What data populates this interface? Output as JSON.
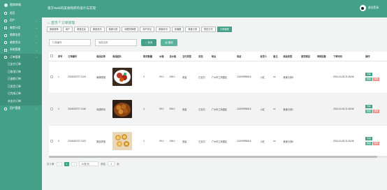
{
  "app": {
    "logo_text": "图商商城",
    "title": "基于Web的美食购买的设计与实现",
    "user_name": "退出登录"
  },
  "sidebar": {
    "items": [
      {
        "label": "首页",
        "has_arrow": false
      },
      {
        "label": "用户",
        "has_arrow": true
      },
      {
        "label": "美食分类",
        "has_arrow": true
      },
      {
        "label": "美食信息",
        "has_arrow": true
      },
      {
        "label": "美食资讯",
        "has_arrow": true
      },
      {
        "label": "系统管理",
        "has_arrow": true
      },
      {
        "label": "订单管理",
        "has_arrow": true
      }
    ],
    "sub_items": [
      "已支付订单",
      "已取消订单",
      "已退款订单",
      "已发货订单",
      "已完成订单",
      "未支付订单"
    ],
    "bottom_item": {
      "label": "用户管理",
      "has_arrow": true
    }
  },
  "breadcrumb": {
    "home": "首页",
    "separator": "/",
    "current": "订单管理"
  },
  "tabs": [
    {
      "label": "美食推荐"
    },
    {
      "label": "用户"
    },
    {
      "label": "美食信息"
    },
    {
      "label": "美食资讯"
    },
    {
      "label": "美食分类"
    },
    {
      "label": "收藏夹管理"
    },
    {
      "label": "用户评论"
    },
    {
      "label": "美食资讯"
    },
    {
      "label": "轮播图"
    },
    {
      "label": "美食分类"
    },
    {
      "label": "配送方式"
    },
    {
      "label": "订单管理",
      "active": true
    }
  ],
  "filters": {
    "order_no_placeholder": "订单编号",
    "dish_name_placeholder": "商品名称",
    "search_label": "查询",
    "delete_label": "删除"
  },
  "table": {
    "columns": [
      "序号",
      "订单编号",
      "商品名称",
      "商品图片",
      "购买数量",
      "价格",
      "总价格",
      "支付类型",
      "状态",
      "地址",
      "电话",
      "收货人",
      "备注",
      "商品类型",
      "退货原因",
      "审核回复",
      "下单时间",
      "操作"
    ],
    "rows": [
      {
        "index": "1",
        "order_no": "2024052707 1243",
        "name": "麻辣香锅",
        "qty": "2",
        "price": "99.0",
        "total": "198.0",
        "pay": "现金",
        "status": "已支付",
        "addr": "广州市工商园区",
        "phone": "1310999988 8",
        "receiver": "小红",
        "note": "xx",
        "type": "美食分类5",
        "reason": "",
        "reply": "",
        "time": "2024-04-05 21:06:56"
      },
      {
        "index": "2",
        "order_no": "2024052707 1246",
        "name": "鸡翅炸鸡",
        "qty": "4",
        "price": "99.0",
        "total": "396.0",
        "pay": "现金",
        "status": "已支付",
        "addr": "广州市工商园区",
        "phone": "1310999988 8",
        "receiver": "小红",
        "note": "xx",
        "type": "美食分类1",
        "reason": "",
        "reply": "",
        "time": "2024-04-05 21:06:56"
      },
      {
        "index": "3",
        "order_no": "2024052707 1322",
        "name": "蛋挞拼盘",
        "qty": "2",
        "price": "99.0",
        "total": "198.0",
        "pay": "现金",
        "status": "已支付",
        "addr": "广州市工商园区",
        "phone": "1310999988 8",
        "receiver": "小红",
        "note": "xx",
        "type": "美食分类6",
        "reason": "",
        "reply": "",
        "time": "2024-04-05 21:06:56"
      }
    ],
    "actions": {
      "view": "查看",
      "edit": "修改",
      "delete": "删除"
    }
  },
  "pagination": {
    "total_label": "共 3 条",
    "prev": "<",
    "current_page": "1",
    "next": ">",
    "page_size": "10条/页",
    "goto_label": "前往",
    "goto_value": "1",
    "page_suffix": "页"
  },
  "colors": {
    "primary": "#45a088",
    "delete": "#f28b82"
  }
}
